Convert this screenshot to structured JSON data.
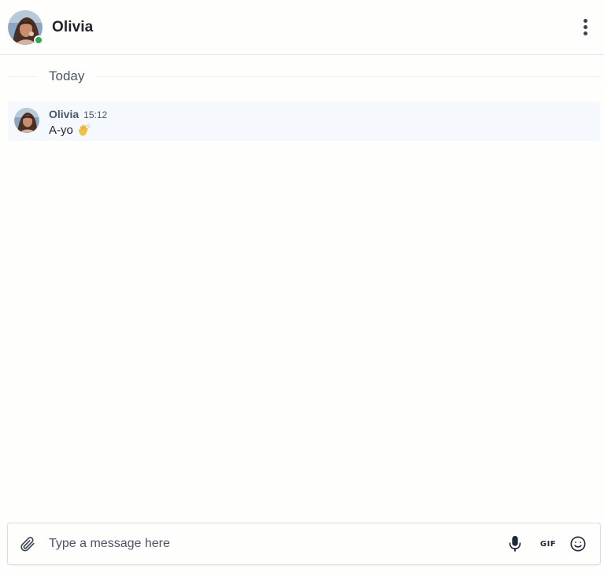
{
  "header": {
    "contact_name": "Olivia",
    "status": "online",
    "status_color": "#2fa84f"
  },
  "divider": {
    "label": "Today"
  },
  "messages": [
    {
      "author": "Olivia",
      "time": "15:12",
      "text": "A-yo",
      "emoji": "waving-hand-icon"
    }
  ],
  "composer": {
    "placeholder": "Type a message here",
    "value": "",
    "icons": [
      "paperclip-icon",
      "microphone-icon",
      "gif-icon",
      "smiley-icon"
    ],
    "gif_label": "GIF"
  },
  "colors": {
    "message_bg": "#f5f8fc",
    "accent_dot": "#2fa84f"
  }
}
